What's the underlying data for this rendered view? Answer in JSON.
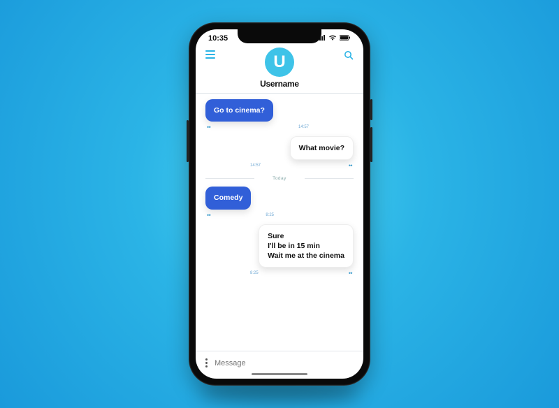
{
  "status": {
    "time": "10:35"
  },
  "header": {
    "avatar_letter": "U",
    "username": "Username"
  },
  "messages": [
    {
      "side": "sent",
      "lines": [
        "Go to cinema?"
      ],
      "time": "14:57"
    },
    {
      "side": "recv",
      "lines": [
        "What movie?"
      ],
      "time": "14:57"
    }
  ],
  "separator": "Today",
  "messages2": [
    {
      "side": "sent",
      "lines": [
        "Comedy"
      ],
      "time": "8:25",
      "small": true
    },
    {
      "side": "recv",
      "lines": [
        "Sure",
        "I'll be in 15 min",
        "Wait me at the cinema"
      ],
      "time": "8:25"
    }
  ],
  "input": {
    "placeholder": "Message"
  }
}
